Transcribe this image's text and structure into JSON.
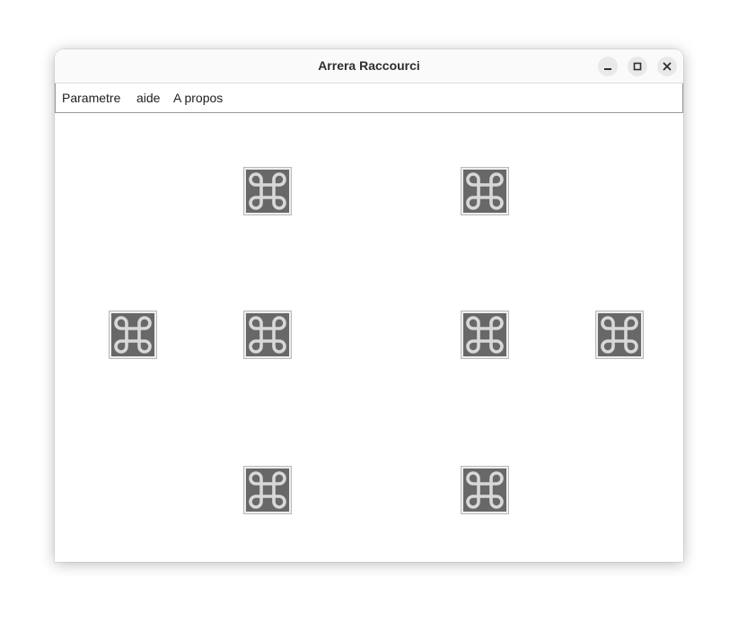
{
  "window": {
    "title": "Arrera Raccourci"
  },
  "menubar": {
    "items": [
      {
        "label": "Parametre"
      },
      {
        "label": "aide"
      },
      {
        "label": "A propos"
      }
    ]
  },
  "shortcuts": {
    "icon": "command-key-icon",
    "buttons": [
      {
        "id": 1,
        "row": 1
      },
      {
        "id": 2,
        "row": 1
      },
      {
        "id": 3,
        "row": 2
      },
      {
        "id": 4,
        "row": 2
      },
      {
        "id": 5,
        "row": 2
      },
      {
        "id": 6,
        "row": 2
      },
      {
        "id": 7,
        "row": 3
      },
      {
        "id": 8,
        "row": 3
      }
    ]
  },
  "colors": {
    "icon_background": "#686868",
    "icon_glyph": "#d8d8d8"
  }
}
